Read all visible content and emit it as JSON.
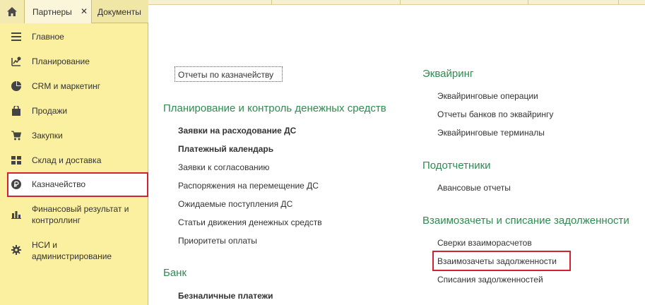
{
  "tabs": {
    "home_icon": "home-icon",
    "partners_label": "Партнеры",
    "partners_close": "✕",
    "documents_label": "Документы"
  },
  "sidebar": {
    "items": [
      {
        "label": "Главное",
        "icon": "menu-icon"
      },
      {
        "label": "Планирование",
        "icon": "planning-icon"
      },
      {
        "label": "CRM и маркетинг",
        "icon": "pie-chart-icon"
      },
      {
        "label": "Продажи",
        "icon": "bag-icon"
      },
      {
        "label": "Закупки",
        "icon": "cart-icon"
      },
      {
        "label": "Склад и доставка",
        "icon": "warehouse-icon"
      },
      {
        "label": "Казначейство",
        "icon": "ruble-icon",
        "selected": true
      },
      {
        "label_line1": "Финансовый результат и",
        "label_line2": "контроллинг",
        "icon": "bar-chart-icon"
      },
      {
        "label_line1": "НСИ и",
        "label_line2": "администрирование",
        "icon": "gear-icon"
      }
    ]
  },
  "main": {
    "top_link": "Отчеты по казначейству",
    "left_sections": [
      {
        "title": "Планирование и контроль денежных средств",
        "links": [
          {
            "label": "Заявки на расходование ДС",
            "bold": true
          },
          {
            "label": "Платежный календарь",
            "bold": true
          },
          {
            "label": "Заявки к согласованию"
          },
          {
            "label": "Распоряжения на перемещение ДС"
          },
          {
            "label": "Ожидаемые поступления ДС"
          },
          {
            "label": "Статьи движения денежных средств"
          },
          {
            "label": "Приоритеты оплаты"
          }
        ]
      },
      {
        "title": "Банк",
        "links": [
          {
            "label": "Безналичные платежи",
            "bold": true
          }
        ]
      }
    ],
    "right_sections": [
      {
        "title": "Эквайринг",
        "links": [
          {
            "label": "Эквайринговые операции"
          },
          {
            "label": "Отчеты банков по эквайрингу"
          },
          {
            "label": "Эквайринговые терминалы"
          }
        ]
      },
      {
        "title": "Подотчетники",
        "links": [
          {
            "label": "Авансовые отчеты"
          }
        ]
      },
      {
        "title": "Взаимозачеты и списание задолженности",
        "links": [
          {
            "label": "Сверки взаиморасчетов"
          },
          {
            "label": "Взаимозачеты задолженности",
            "highlighted": true
          },
          {
            "label": "Списания задолженностей"
          }
        ]
      }
    ]
  },
  "colors": {
    "sidebar_bg": "#fbf0a0",
    "section_title": "#2d8c50",
    "highlight_border": "#d2212f",
    "text": "#333333"
  }
}
